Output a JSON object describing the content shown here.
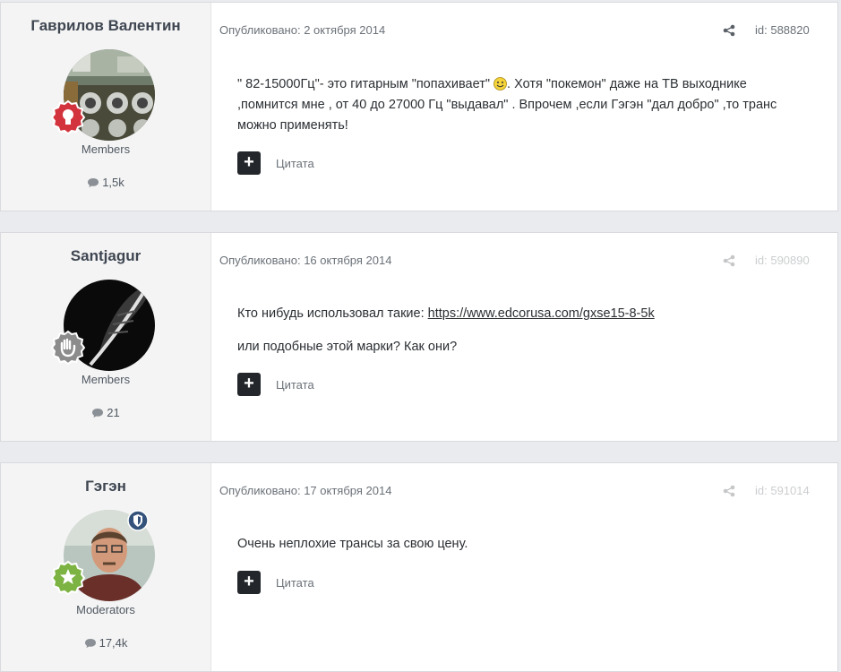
{
  "posts": [
    {
      "author": "Гаврилов Валентин",
      "group": "Members",
      "count": "1,5k",
      "published": "Опубликовано: 2 октября 2014",
      "id": "id: 588820",
      "text_line1_a": "\" 82-15000Гц\"- это гитарным \"попахивает\" ",
      "text_line1_b": ". Хотя \"покемон\" даже на ТВ выходнике",
      "text_line2": ",помнится мне , от 40 до 27000 Гц \"выдавал\" . Впрочем ,если Гэгэн \"дал добро\" ,то транс",
      "text_line3": "можно применять!",
      "quote_label": "Цитата",
      "rank_icon": "lightbulb-rank-icon",
      "rank_color": "#d2333c"
    },
    {
      "author": "Santjagur",
      "group": "Members",
      "count": "21",
      "published": "Опубликовано: 16 октября 2014",
      "id": "id: 590890",
      "text_prefix": "Кто нибудь использовал такие: ",
      "link": "https://www.edcorusa.com/gxse15-8-5k",
      "text_line2": "или подобные этой марки? Как они?",
      "quote_label": "Цитата",
      "rank_icon": "hand-rank-icon",
      "rank_color": "#8c8c8c"
    },
    {
      "author": "Гэгэн",
      "group": "Moderators",
      "count": "17,4k",
      "published": "Опубликовано: 17 октября 2014",
      "id": "id: 591014",
      "text": "Очень неплохие трансы за свою цену.",
      "quote_label": "Цитата",
      "rank_icon": "star-rank-icon",
      "rank_color": "#7cb342",
      "badge_icon": "moderator-shield-icon"
    }
  ],
  "colors": {
    "background": "#e9ebee",
    "author_panel": "#f4f4f4",
    "button": "#23272b"
  }
}
